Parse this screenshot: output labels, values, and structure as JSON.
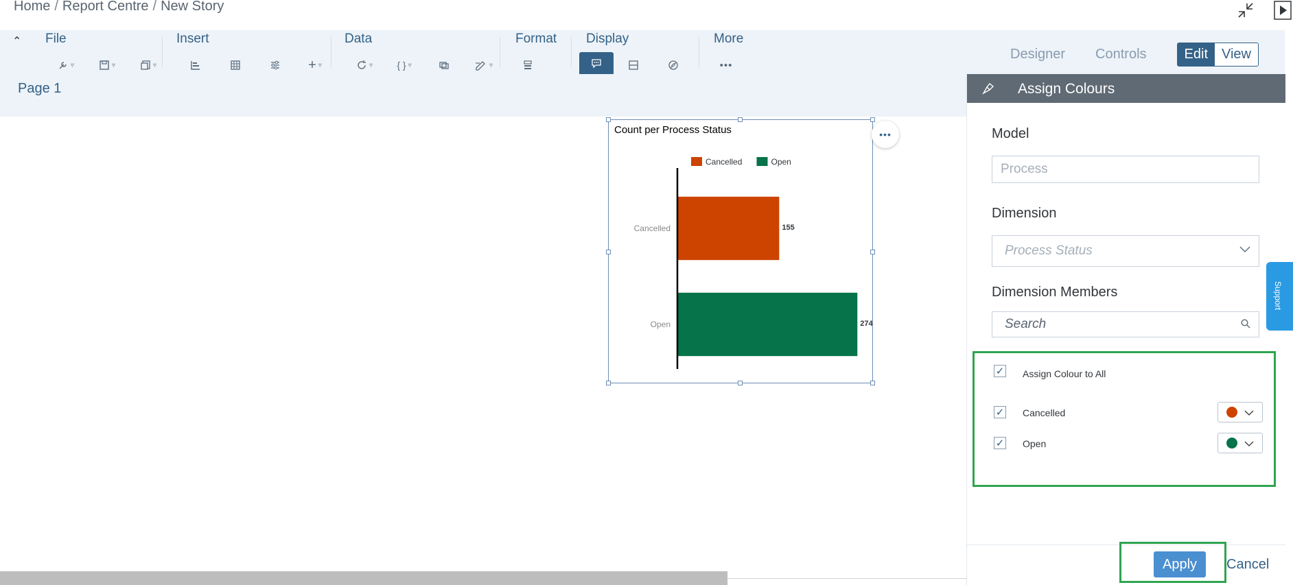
{
  "breadcrumb": {
    "items": [
      "Home",
      "Report Centre",
      "New Story"
    ],
    "separator": "/"
  },
  "top_icons": [
    "collapse-fullscreen-icon",
    "present-play-icon"
  ],
  "toolbar": {
    "groups": [
      {
        "label": "File",
        "icons": [
          "wrench-icon",
          "save-icon",
          "copy-icon"
        ]
      },
      {
        "label": "Insert",
        "icons": [
          "chart-icon",
          "table-icon",
          "input-control-icon",
          "add-icon"
        ]
      },
      {
        "label": "Data",
        "icons": [
          "refresh-icon",
          "formula-icon",
          "linked-analysis-icon",
          "edit-data-icon"
        ]
      },
      {
        "label": "Format",
        "icons": [
          "styling-icon"
        ]
      },
      {
        "label": "Display",
        "icons": [
          "comment-icon",
          "layout-icon",
          "explorer-icon"
        ]
      },
      {
        "label": "More",
        "icons": [
          "more-icon"
        ]
      }
    ],
    "modes": {
      "designer": "Designer",
      "controls": "Controls",
      "edit": "Edit",
      "view": "View"
    }
  },
  "page_tab": "Page 1",
  "chart": {
    "more_icon": "more-horizontal-icon",
    "chart_data": {
      "type": "bar",
      "orientation": "horizontal",
      "title": "Count per Process Status",
      "categories": [
        "Cancelled",
        "Open"
      ],
      "values": [
        155,
        274
      ],
      "colors": [
        "#cc4400",
        "#06734a"
      ],
      "legend": [
        "Cancelled",
        "Open"
      ],
      "legend_position": "top",
      "xlim": [
        0,
        280
      ]
    }
  },
  "panel": {
    "title": "Assign Colours",
    "header_icon": "paint-brush-icon",
    "model_label": "Model",
    "model_value": "Process",
    "dimension_label": "Dimension",
    "dimension_value": "Process Status",
    "members_label": "Dimension Members",
    "search_placeholder": "Search",
    "assign_all_label": "Assign Colour to All",
    "members": [
      {
        "label": "Cancelled",
        "color": "#cc4400"
      },
      {
        "label": "Open",
        "color": "#06734a"
      }
    ],
    "apply_label": "Apply",
    "cancel_label": "Cancel"
  },
  "support_label": "Support"
}
